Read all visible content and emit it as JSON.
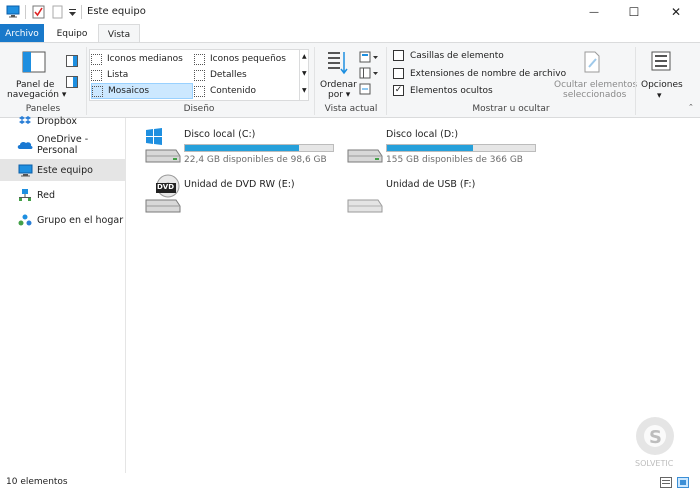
{
  "window": {
    "title": "Este equipo",
    "minimize_glyph": "—",
    "maximize_glyph": "☐",
    "close_glyph": "✕"
  },
  "tabs": [
    "Archivo",
    "Equipo",
    "Vista"
  ],
  "ribbon": {
    "panes": {
      "nav_pane_line1": "Panel de",
      "nav_pane_line2": "navegación ▾",
      "group_label": "Paneles"
    },
    "layout": {
      "items": [
        "Iconos medianos",
        "Iconos pequeños",
        "Lista",
        "Detalles",
        "Mosaicos",
        "Contenido"
      ],
      "selected": "Mosaicos",
      "group_label": "Diseño"
    },
    "current_view": {
      "sort_line1": "Ordenar",
      "sort_line2": "por ▾",
      "group_label": "Vista actual"
    },
    "show_hide": {
      "checkboxes": [
        {
          "label": "Casillas de elemento",
          "checked": false
        },
        {
          "label": "Extensiones de nombre de archivo",
          "checked": false
        },
        {
          "label": "Elementos ocultos",
          "checked": true
        }
      ],
      "hide_selected_line1": "Ocultar elementos",
      "hide_selected_line2": "seleccionados",
      "group_label": "Mostrar u ocultar"
    },
    "options": {
      "label": "Opciones",
      "chevron": "▾"
    }
  },
  "nav_pane": {
    "items": [
      "Dropbox",
      "OneDrive - Personal",
      "Este equipo",
      "Red",
      "Grupo en el hogar"
    ],
    "selected": "Este equipo"
  },
  "drives": [
    {
      "name": "Disco local (C:)",
      "free_text": "22,4 GB disponibles de 98,6 GB",
      "used_fraction": 0.77,
      "icon": "windows-drive-icon"
    },
    {
      "name": "Disco local (D:)",
      "free_text": "155 GB disponibles de 366 GB",
      "used_fraction": 0.58,
      "icon": "hard-drive-icon"
    },
    {
      "name": "Unidad de DVD RW (E:)",
      "icon": "dvd-drive-icon",
      "dvd_label": "DVD"
    },
    {
      "name": "Unidad de USB (F:)",
      "icon": "usb-drive-icon"
    }
  ],
  "status": {
    "item_count": "10 elementos"
  },
  "colors": {
    "accent": "#1979ca",
    "bar_fill": "#26a0da",
    "selection": "#cce8ff"
  }
}
